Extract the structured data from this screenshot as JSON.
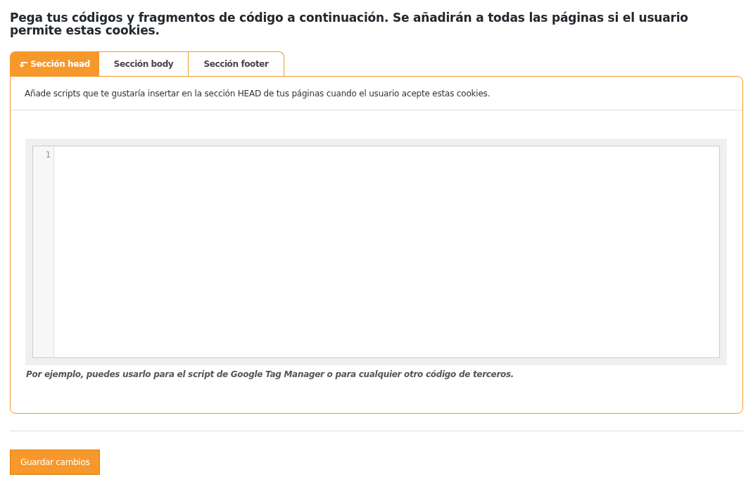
{
  "heading": "Pega tus códigos y fragmentos de código a continuación. Se añadirán a todas las páginas si el usuario permite estas cookies.",
  "tabs": [
    {
      "label": "Sección head",
      "selected": true
    },
    {
      "label": "Sección body",
      "selected": false
    },
    {
      "label": "Sección footer",
      "selected": false
    }
  ],
  "panel": {
    "description": "Añade scripts que te gustaría insertar en la sección HEAD de tus páginas cuando el usuario acepte estas cookies.",
    "editor": {
      "line_numbers": [
        "1"
      ]
    },
    "note": "Por ejemplo, puedes usarlo para el script de Google Tag Manager o para cualquier otro código de terceros."
  },
  "save_button": "Guardar cambios"
}
